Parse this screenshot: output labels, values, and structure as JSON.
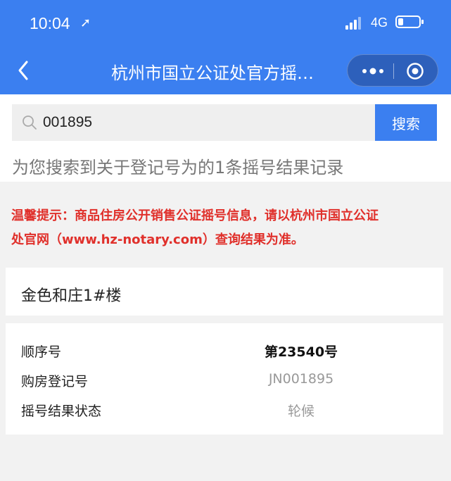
{
  "status_bar": {
    "time": "10:04",
    "network": "4G"
  },
  "nav": {
    "title": "杭州市国立公证处官方摇…"
  },
  "search": {
    "value": "001895",
    "button_label": "搜索"
  },
  "result_note": "为您搜索到关于登记号为的1条摇号结果记录",
  "tip": {
    "line1": "温馨提示：商品住房公开销售公证摇号信息，请以杭州市国立公证",
    "line2": "处官网（www.hz-notary.com）查询结果为准。"
  },
  "project": {
    "name": "金色和庄1#楼"
  },
  "details": [
    {
      "label": "顺序号",
      "value": "第23540号"
    },
    {
      "label": "购房登记号",
      "value": "JN001895"
    },
    {
      "label": "摇号结果状态",
      "value": "轮候"
    }
  ],
  "colors": {
    "brand_blue": "#3b7ff0",
    "tip_red": "#e0302b"
  }
}
